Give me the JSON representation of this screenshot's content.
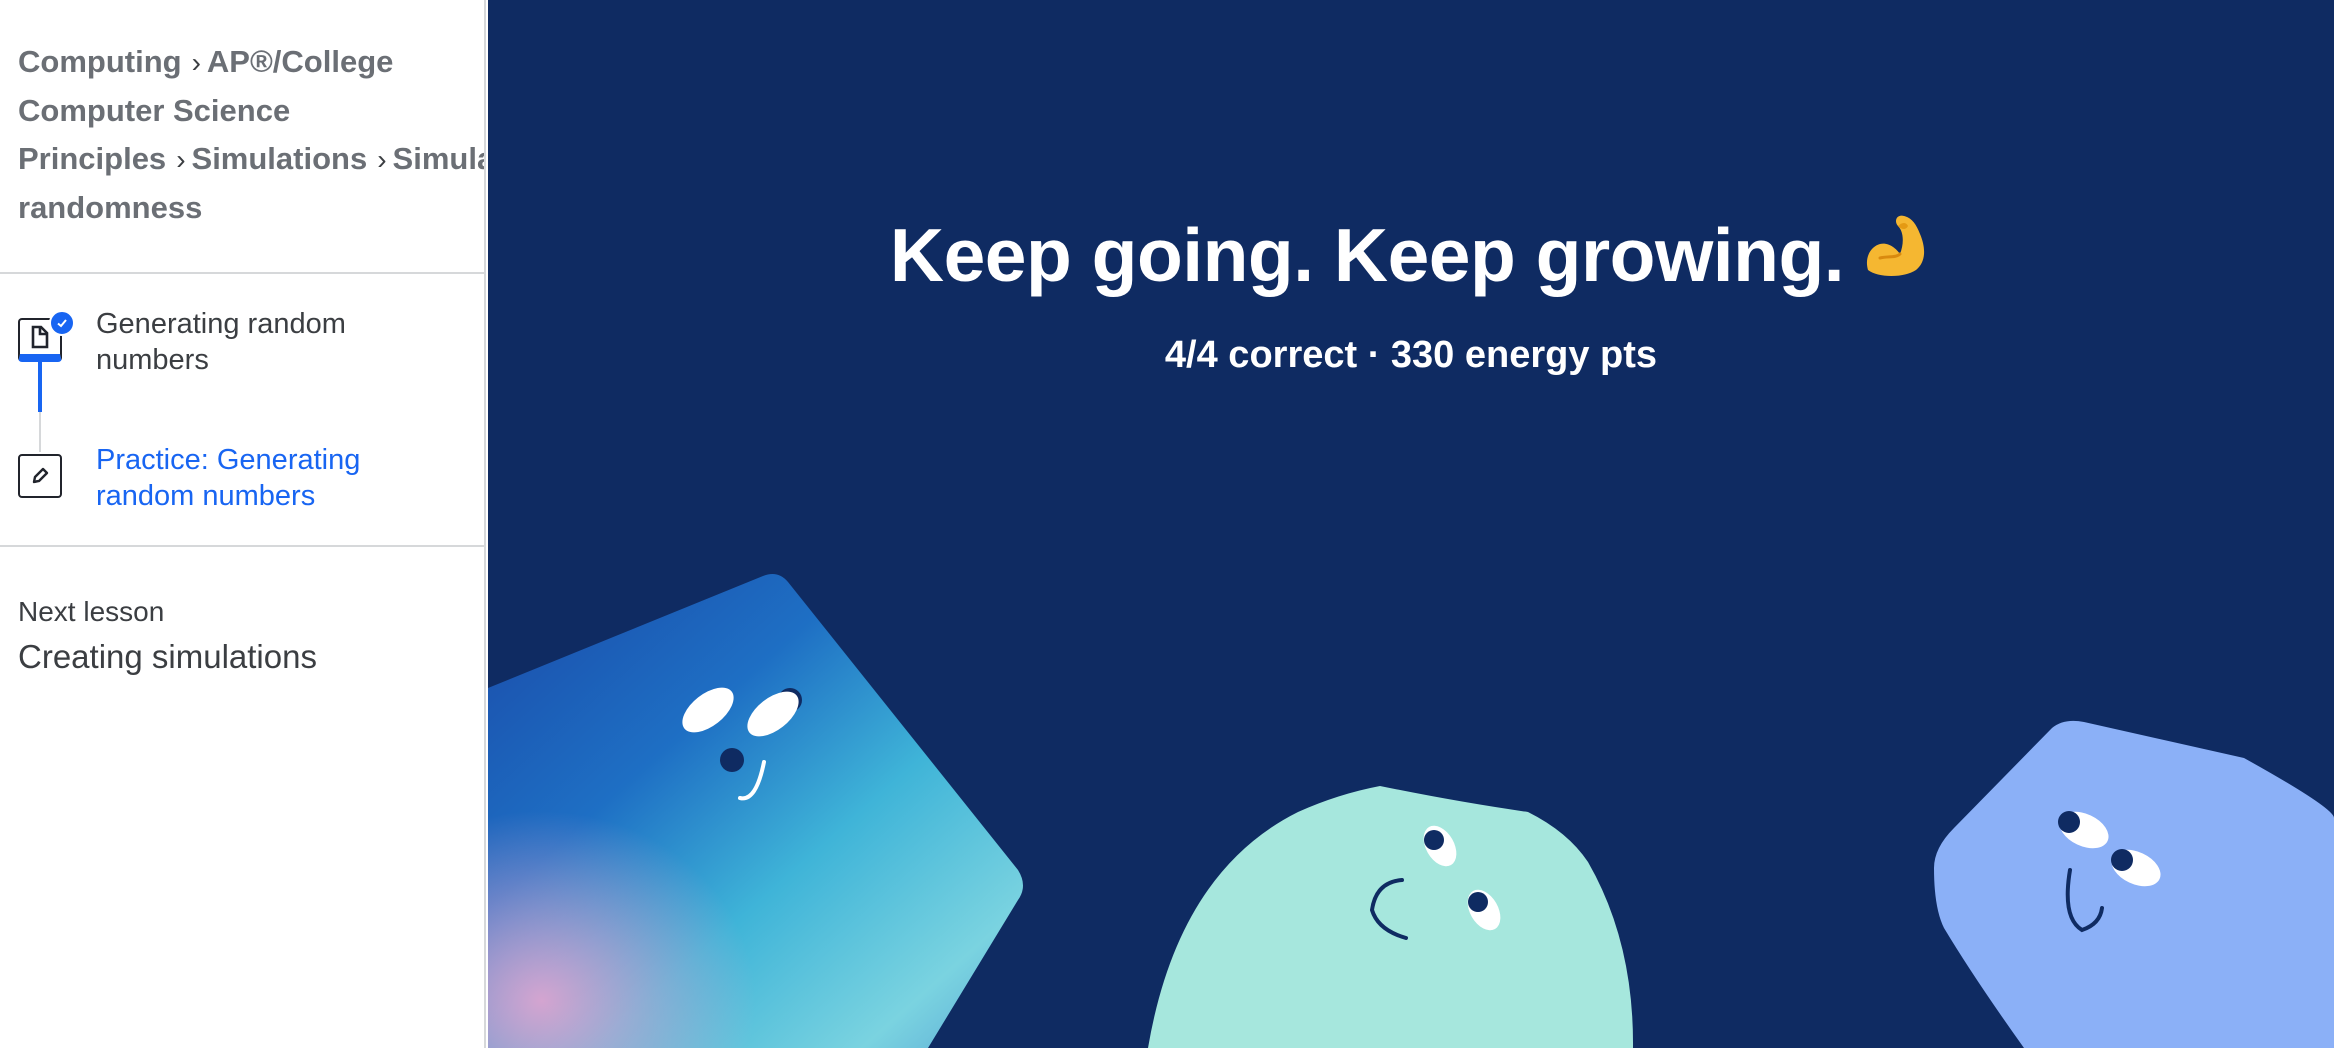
{
  "breadcrumb": {
    "items": [
      "Computing",
      "AP®/College",
      "Computer Science",
      "Principles",
      "Simulations",
      "Simulat",
      "randomness"
    ]
  },
  "lesson_items": [
    {
      "label_line1": "Generating random",
      "label_line2": "numbers",
      "status": "completed",
      "icon": "article-icon"
    },
    {
      "label_line1": "Practice: Generating",
      "label_line2": "random numbers",
      "status": "current",
      "icon": "pencil-icon"
    }
  ],
  "next_lesson": {
    "label": "Next lesson",
    "title": "Creating simulations"
  },
  "main": {
    "headline": "Keep going. Keep growing.",
    "headline_emoji": "flexed-biceps",
    "result": "4/4 correct · 330 energy pts"
  },
  "colors": {
    "background": "#0f2b62",
    "accent": "#1865f2",
    "blob_teal": "#a6e7dd",
    "blob_lavender": "#8bb0f7"
  }
}
